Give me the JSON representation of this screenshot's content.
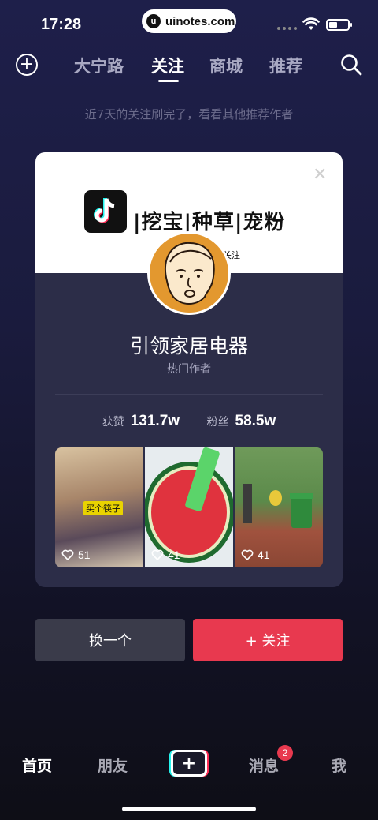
{
  "status": {
    "time": "17:28",
    "watermark": "uinotes.com"
  },
  "topnav": {
    "tabs": [
      {
        "label": "大宁路",
        "active": false
      },
      {
        "label": "关注",
        "active": true
      },
      {
        "label": "商城",
        "active": false
      },
      {
        "label": "推荐",
        "active": false
      }
    ]
  },
  "hint": "近7天的关注刷完了，看看其他推荐作者",
  "card": {
    "banner_text": "|挖宝|种草|宠粉",
    "banner_sub": "关注",
    "author_name": "引领家居电器",
    "author_role": "热门作者",
    "stats": {
      "likes_label": "获赞",
      "likes_value": "131.7w",
      "fans_label": "粉丝",
      "fans_value": "58.5w"
    },
    "videos": [
      {
        "caption": "买个筷子",
        "likes": "51"
      },
      {
        "caption": "",
        "likes": "41"
      },
      {
        "caption": "",
        "likes": "41"
      }
    ]
  },
  "buttons": {
    "switch": "换一个",
    "follow": "+ 关注"
  },
  "bottom_nav": {
    "items": [
      "首页",
      "朋友",
      "消息",
      "我"
    ],
    "create_label": "+",
    "message_badge": "2"
  },
  "colors": {
    "accent": "#e8394f",
    "avatar_bg": "#e3982f",
    "card_bg": "#2c2d48"
  }
}
